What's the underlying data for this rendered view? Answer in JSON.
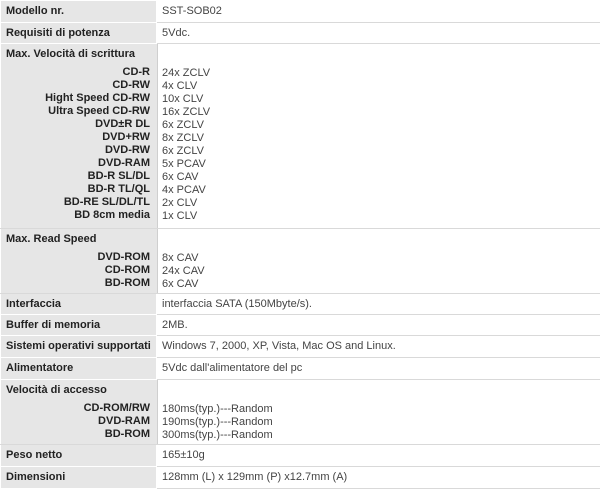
{
  "rows": [
    {
      "label": "Modello nr.",
      "value": "SST-SOB02"
    },
    {
      "label": "Requisiti di potenza",
      "value": "5Vdc."
    },
    {
      "label": "Max. Velocità di scrittura",
      "items": [
        {
          "k": "CD-R",
          "v": "24x ZCLV"
        },
        {
          "k": "CD-RW",
          "v": "4x CLV"
        },
        {
          "k": "Hight Speed CD-RW",
          "v": "10x CLV"
        },
        {
          "k": "Ultra Speed CD-RW",
          "v": "16x ZCLV"
        },
        {
          "k": "DVD±R DL",
          "v": "6x ZCLV"
        },
        {
          "k": "DVD+RW",
          "v": "8x ZCLV"
        },
        {
          "k": "DVD-RW",
          "v": "6x ZCLV"
        },
        {
          "k": "DVD-RAM",
          "v": "5x PCAV"
        },
        {
          "k": "BD-R SL/DL",
          "v": "6x CAV"
        },
        {
          "k": "BD-R TL/QL",
          "v": "4x PCAV"
        },
        {
          "k": "BD-RE SL/DL/TL",
          "v": "2x CLV"
        },
        {
          "k": "BD 8cm media",
          "v": "1x CLV"
        }
      ]
    },
    {
      "label": "Max. Read Speed",
      "items": [
        {
          "k": "DVD-ROM",
          "v": "8x CAV"
        },
        {
          "k": "CD-ROM",
          "v": "24x CAV"
        },
        {
          "k": "BD-ROM",
          "v": "6x CAV"
        }
      ]
    },
    {
      "label": "Interfaccia",
      "value": "interfaccia SATA (150Mbyte/s)."
    },
    {
      "label": "Buffer di memoria",
      "value": "2MB."
    },
    {
      "label": "Sistemi operativi supportati",
      "value": "Windows 7, 2000, XP, Vista, Mac OS and Linux."
    },
    {
      "label": "Alimentatore",
      "value": "5Vdc dall'alimentatore del pc"
    },
    {
      "label": "Velocità di accesso",
      "items": [
        {
          "k": "CD-ROM/RW",
          "v": "180ms(typ.)---Random"
        },
        {
          "k": "DVD-RAM",
          "v": "190ms(typ.)---Random"
        },
        {
          "k": "BD-ROM",
          "v": "300ms(typ.)---Random"
        }
      ]
    },
    {
      "label": "Peso netto",
      "value": "165±10g"
    },
    {
      "label": "Dimensioni",
      "value": "128mm (L) x 129mm (P) x12.7mm (A)"
    }
  ]
}
